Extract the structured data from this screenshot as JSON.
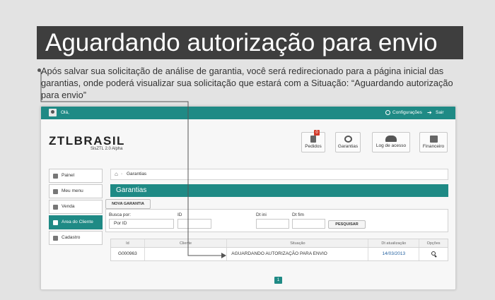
{
  "banner": {
    "title": "Aguardando autorização para envio"
  },
  "description": {
    "text": "Após salvar sua solicitação de análise de garantia, você será redirecionado para a página inicial das garantias, onde poderá visualizar sua solicitação que estará com a Situação: “Aguardando autorização para envio”"
  },
  "topbar": {
    "user_label": "Olá,",
    "config_label": "Configurações",
    "exit_label": "Sair",
    "color": "#1f8a85"
  },
  "brand": {
    "logo": "ZTLBRASIL",
    "subtitle": "SisZTL 2.0 Alpha"
  },
  "modules": [
    {
      "label": "Pedidos",
      "icon": "orders-icon",
      "badge": "0"
    },
    {
      "label": "Garantias",
      "icon": "gears-icon"
    },
    {
      "label": "Log de acesso",
      "icon": "users-icon"
    },
    {
      "label": "Financeiro",
      "icon": "finance-icon"
    }
  ],
  "sidebar": {
    "items": [
      {
        "label": "Painel",
        "icon": "power-icon",
        "active": false
      },
      {
        "label": "Meu menu",
        "icon": "star-icon",
        "active": false
      },
      {
        "label": "Venda",
        "icon": "book-icon",
        "active": false
      },
      {
        "label": "Area do Cliente",
        "icon": "user-icon",
        "active": true
      },
      {
        "label": "Cadastro",
        "icon": "edit-icon",
        "active": false
      }
    ]
  },
  "breadcrumb": {
    "current": "Garantias",
    "icon": "home-icon"
  },
  "section": {
    "title": "Garantias"
  },
  "actions": {
    "new_label": "NOVA GARANTIA"
  },
  "filters": {
    "search_by_label": "Busca por:",
    "search_by_value": "Por ID",
    "id_label": "ID",
    "id_value": "",
    "dt_start_label": "Dt ini",
    "dt_start_value": "",
    "dt_end_label": "Dt fim",
    "dt_end_value": "",
    "search_button": "PESQUISAR"
  },
  "table": {
    "columns": [
      "Id",
      "Cliente",
      "Situação",
      "Dt atualização",
      "Opções"
    ],
    "rows": [
      {
        "id": "G000963",
        "client": "",
        "status": "AGUARDANDO AUTORIZAÇÃO PARA ENVIO",
        "updated": "14/03/2013",
        "option_icon": "search-icon"
      }
    ]
  },
  "pagination": {
    "current_page": "1"
  }
}
